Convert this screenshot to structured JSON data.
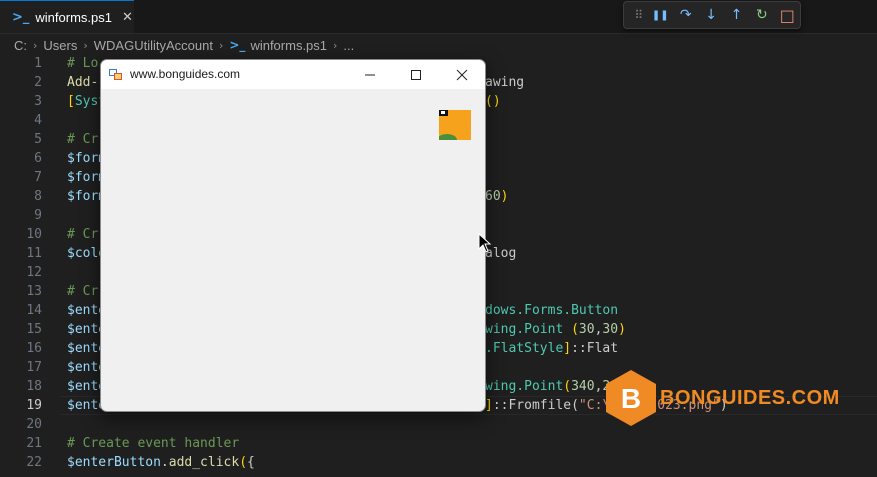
{
  "tab": {
    "label": "winforms.ps1",
    "close": "✕"
  },
  "breadcrumb": [
    "C:",
    "Users",
    "WDAGUtilityAccount",
    "winforms.ps1",
    "..."
  ],
  "debug_toolbar": {
    "grip": "⠿",
    "pause": "❚❚",
    "step_over": "↷",
    "step_into": "↓",
    "step_out": "↑",
    "restart": "↻",
    "stop": "□"
  },
  "lines": [
    {
      "n": "1",
      "tokens": [
        {
          "t": "c-comment",
          "v": "# Lo"
        }
      ]
    },
    {
      "n": "2",
      "tokens": [
        {
          "t": "c-fn",
          "v": "Add-"
        }
      ],
      "tail": [
        {
          "t": "c-plain",
          "v": "awing"
        }
      ]
    },
    {
      "n": "3",
      "tokens": [
        {
          "t": "c-brk",
          "v": "["
        },
        {
          "t": "c-type",
          "v": "Syst"
        }
      ],
      "tail": [
        {
          "t": "c-brk",
          "v": "()"
        }
      ]
    },
    {
      "n": "4",
      "tokens": []
    },
    {
      "n": "5",
      "tokens": [
        {
          "t": "c-comment",
          "v": "# Cr"
        }
      ]
    },
    {
      "n": "6",
      "tokens": [
        {
          "t": "c-var",
          "v": "$form"
        }
      ]
    },
    {
      "n": "7",
      "tokens": [
        {
          "t": "c-var",
          "v": "$form"
        }
      ]
    },
    {
      "n": "8",
      "tokens": [
        {
          "t": "c-var",
          "v": "$form"
        }
      ],
      "tail": [
        {
          "t": "c-num",
          "v": "60"
        },
        {
          "t": "c-brk",
          "v": ")"
        }
      ]
    },
    {
      "n": "9",
      "tokens": []
    },
    {
      "n": "10",
      "tokens": [
        {
          "t": "c-comment",
          "v": "# Cr"
        }
      ]
    },
    {
      "n": "11",
      "tokens": [
        {
          "t": "c-var",
          "v": "$colo"
        }
      ],
      "tail": [
        {
          "t": "c-plain",
          "v": "alog"
        }
      ]
    },
    {
      "n": "12",
      "tokens": []
    },
    {
      "n": "13",
      "tokens": [
        {
          "t": "c-comment",
          "v": "# Cr"
        }
      ]
    },
    {
      "n": "14",
      "tokens": [
        {
          "t": "c-var",
          "v": "$ente"
        }
      ],
      "tail": [
        {
          "t": "c-type",
          "v": "dows.Forms.Button"
        }
      ]
    },
    {
      "n": "15",
      "tokens": [
        {
          "t": "c-var",
          "v": "$ente"
        }
      ],
      "tail": [
        {
          "t": "c-type",
          "v": "wing.Point "
        },
        {
          "t": "c-brk",
          "v": "("
        },
        {
          "t": "c-num",
          "v": "30"
        },
        {
          "t": "c-plain",
          "v": ","
        },
        {
          "t": "c-num",
          "v": "30"
        },
        {
          "t": "c-brk",
          "v": ")"
        }
      ]
    },
    {
      "n": "16",
      "tokens": [
        {
          "t": "c-var",
          "v": "$ente"
        }
      ],
      "tail": [
        {
          "t": "c-type",
          "v": ".FlatStyle"
        },
        {
          "t": "c-brk",
          "v": "]"
        },
        {
          "t": "c-plain",
          "v": "::Flat"
        }
      ]
    },
    {
      "n": "17",
      "tokens": [
        {
          "t": "c-var",
          "v": "$ente"
        }
      ]
    },
    {
      "n": "18",
      "tokens": [
        {
          "t": "c-var",
          "v": "$ente"
        }
      ],
      "tail": [
        {
          "t": "c-type",
          "v": "wing.Point"
        },
        {
          "t": "c-brk",
          "v": "("
        },
        {
          "t": "c-num",
          "v": "340"
        },
        {
          "t": "c-plain",
          "v": ","
        },
        {
          "t": "c-num",
          "v": "20"
        },
        {
          "t": "c-brk",
          "v": ")"
        }
      ]
    },
    {
      "n": "19",
      "active": true,
      "tokens": [
        {
          "t": "c-var",
          "v": "$ente"
        }
      ],
      "tail": [
        {
          "t": "c-brk",
          "v": "]"
        },
        {
          "t": "c-plain",
          "v": "::Fromfile("
        },
        {
          "t": "c-str",
          "v": "\"C:\\im...2023.png\""
        },
        {
          "t": "c-plain",
          "v": ")"
        }
      ]
    },
    {
      "n": "20",
      "tokens": []
    },
    {
      "n": "21",
      "tokens": [
        {
          "t": "c-comment",
          "v": "# Create event handler"
        }
      ]
    },
    {
      "n": "22",
      "tokens": [
        {
          "t": "c-var",
          "v": "$enterButton"
        },
        {
          "t": "c-plain",
          "v": "."
        },
        {
          "t": "c-fn",
          "v": "add_click"
        },
        {
          "t": "c-brk",
          "v": "("
        },
        {
          "t": "c-plain",
          "v": "{"
        }
      ]
    }
  ],
  "window": {
    "title": "www.bonguides.com",
    "minimize": "—",
    "maximize": "☐",
    "close": "✕"
  },
  "watermark": {
    "text": "BONGUIDES.COM",
    "letter": "B",
    "color": "#f08a24"
  }
}
